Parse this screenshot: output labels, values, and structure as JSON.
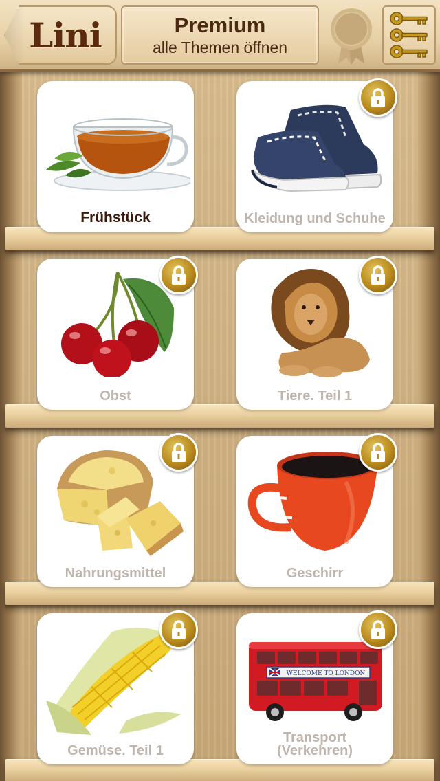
{
  "header": {
    "logo_text": "Lini",
    "premium_title": "Premium",
    "premium_subtitle": "alle Themen öffnen"
  },
  "topics": [
    {
      "label": "Frühstück",
      "locked": false,
      "icon": "tea-cup-icon"
    },
    {
      "label": "Kleidung  und Schuhe",
      "locked": true,
      "icon": "sneakers-icon"
    },
    {
      "label": "Obst",
      "locked": true,
      "icon": "cherries-icon"
    },
    {
      "label": "Tiere. Teil 1",
      "locked": true,
      "icon": "lion-icon"
    },
    {
      "label": "Nahrungsmittel",
      "locked": true,
      "icon": "cheese-icon"
    },
    {
      "label": "Geschirr",
      "locked": true,
      "icon": "red-cup-icon"
    },
    {
      "label": "Gemüse. Teil 1",
      "locked": true,
      "icon": "corn-icon"
    },
    {
      "label": "Transport (Verkehren)",
      "locked": true,
      "icon": "london-bus-icon"
    }
  ],
  "bus_sign": "WELCOME TO LONDON",
  "colors": {
    "wood_light": "#ecd2a2",
    "wood_dark": "#6e5234",
    "lock_gold": "#b98a1e",
    "label_active": "#3b1a0a",
    "label_locked": "#bfb5ac"
  }
}
